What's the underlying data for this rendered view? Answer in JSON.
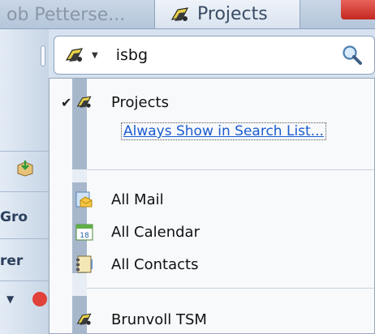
{
  "tabs": {
    "left_label": "ob Pettersе...",
    "projects_label": "Projects"
  },
  "left_panel": {
    "label_1": "Gro",
    "label_2": "rer"
  },
  "search": {
    "query": "isbg"
  },
  "menu": {
    "projects": "Projects",
    "always_show": "Always Show in Search List...",
    "all_mail": "All Mail",
    "all_calendar": "All Calendar",
    "all_contacts": "All Contacts",
    "brunvoll": "Brunvoll TSM",
    "calendar_day": "18"
  },
  "colors": {
    "link": "#1b5ccf",
    "close_red": "#c3281f"
  },
  "icons": {
    "projects": "project-folder-icon",
    "mail": "mail-icon",
    "calendar": "calendar-icon",
    "contacts": "contacts-icon",
    "search": "magnifier-icon"
  }
}
